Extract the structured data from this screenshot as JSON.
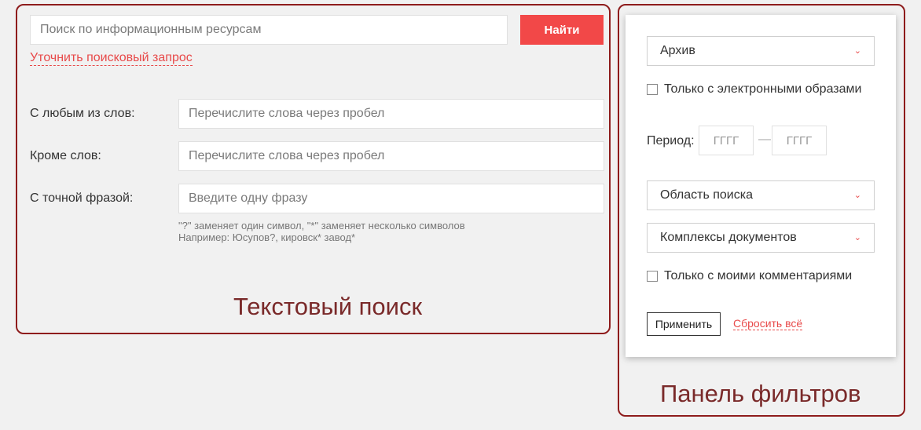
{
  "text_search": {
    "search_placeholder": "Поиск по информационным ресурсам",
    "find_label": "Найти",
    "refine_label": "Уточнить поисковый запрос",
    "fields": [
      {
        "label": "С любым из слов:",
        "placeholder": "Перечислите слова через пробел"
      },
      {
        "label": "Кроме слов:",
        "placeholder": "Перечислите слова через пробел"
      },
      {
        "label": "С точной фразой:",
        "placeholder": "Введите одну фразу"
      }
    ],
    "hint_line1": "\"?\" заменяет один символ, \"*\" заменяет несколько символов",
    "hint_line2": "Например: Юсупов?, кировск* завод*",
    "caption": "Текстовый поиск"
  },
  "filter_panel": {
    "archive_select": "Архив",
    "only_images_label": "Только с электронными образами",
    "only_images_checked": false,
    "period_label": "Период:",
    "year_from_placeholder": "ГГГГ",
    "year_to_placeholder": "ГГГГ",
    "period_separator": "—",
    "search_area_select": "Область поиска",
    "doc_complexes_select": "Комплексы документов",
    "only_comments_label": "Только с моими комментариями",
    "only_comments_checked": false,
    "apply_label": "Применить",
    "reset_label": "Сбросить всё",
    "caption": "Панель фильтров",
    "chevron_icon": "chevron-down-icon"
  },
  "colors": {
    "accent": "#f24848",
    "frame": "#8e1c1c",
    "caption": "#7a2a2a",
    "link": "#e84a4a",
    "background": "#f1f1f1"
  }
}
